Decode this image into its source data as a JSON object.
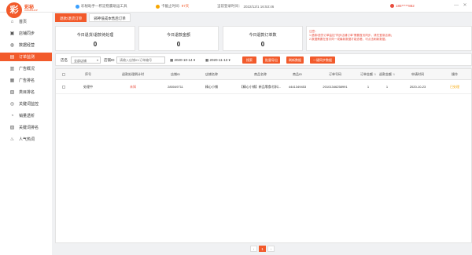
{
  "app": {
    "logo_glyph": "彩",
    "name": "彩秘",
    "sub": "CAIMISHOP",
    "brand_color": "#f25a2b"
  },
  "topbar": {
    "promo": "彩秘助手—积淀稳赢助运工具",
    "expiry_label": "卡截止时间:",
    "expiry_value": "97天",
    "login_label": "当前登录时间：",
    "login_value": "2022/12/1 16:53:46",
    "user": "185*****882",
    "win_min": "—",
    "win_close": "✕"
  },
  "sidebar": {
    "items": [
      {
        "label": "首页",
        "icon": "home-icon",
        "glyph": "⌂",
        "active": false
      },
      {
        "label": "店铺同步",
        "icon": "store-sync-icon",
        "glyph": "▣",
        "active": false
      },
      {
        "label": "数据经营",
        "icon": "data-icon",
        "glyph": "◍",
        "active": false
      },
      {
        "label": "订单监测",
        "icon": "order-icon",
        "glyph": "▤",
        "active": true
      },
      {
        "label": "广告概况",
        "icon": "ad-overview-icon",
        "glyph": "▥",
        "active": false
      },
      {
        "label": "广告排名",
        "icon": "ad-rank-icon",
        "glyph": "▦",
        "active": false
      },
      {
        "label": "类目排名",
        "icon": "category-icon",
        "glyph": "▧",
        "active": false
      },
      {
        "label": "关键词监控",
        "icon": "keyword-monitor-icon",
        "glyph": "◎",
        "active": false
      },
      {
        "label": "销量透析",
        "icon": "sales-icon",
        "glyph": "◔",
        "active": false
      },
      {
        "label": "关键词排名",
        "icon": "keyword-rank-icon",
        "glyph": "▨",
        "active": false
      },
      {
        "label": "人气热词",
        "icon": "hot-word-icon",
        "glyph": "♨",
        "active": false
      }
    ]
  },
  "tabs": [
    {
      "label": "退款/退货订单",
      "active": true
    },
    {
      "label": "邪神低成本售后订单",
      "active": false
    }
  ],
  "stats": [
    {
      "label": "今日退货/退款待处理",
      "value": "0"
    },
    {
      "label": "今日退款金额",
      "value": "0"
    },
    {
      "label": "今日退款订单数",
      "value": "0"
    }
  ],
  "notice": {
    "title": "注意：",
    "line1": "1.退款/退货订单监控\"同步店铺订单\"需要首页同步，请先登录店铺；",
    "line2": "2.数据需要在首次同一或最新数据才能查看，可点击刷新数据。"
  },
  "filter": {
    "shop_label": "店名",
    "shop_value": "全部店铺",
    "order_label": "店铺ID",
    "order_placeholder": "请输入店铺ID/订单编号",
    "date_start": "2020-10-14",
    "date_end": "2020-11-13",
    "btn_search": "搜索",
    "btn_export": "批量导出",
    "btn_refresh": "刷新数据",
    "btn_sync": "一键同步数据"
  },
  "table": {
    "columns": [
      "",
      "序号",
      "退款处理倒计时",
      "店铺ID",
      "店铺名称",
      "商品名称",
      "商品ID",
      "订单号码",
      "订单金额",
      "退款金额",
      "申请时间",
      "操作"
    ],
    "rows": [
      {
        "index": "处理中",
        "countdown": "未知",
        "shop_id": "280049711",
        "shop_name": "精心小铺",
        "product": "【精心小铺】新品零食/饮料...",
        "product_id": "4441349453",
        "order_no": "20101346258991",
        "order_amount": "1",
        "refund_amount": "1",
        "apply_time": "2020-10-23",
        "action": "已处理"
      }
    ]
  },
  "pager": {
    "prev": "‹",
    "current": "1",
    "next": "›"
  }
}
